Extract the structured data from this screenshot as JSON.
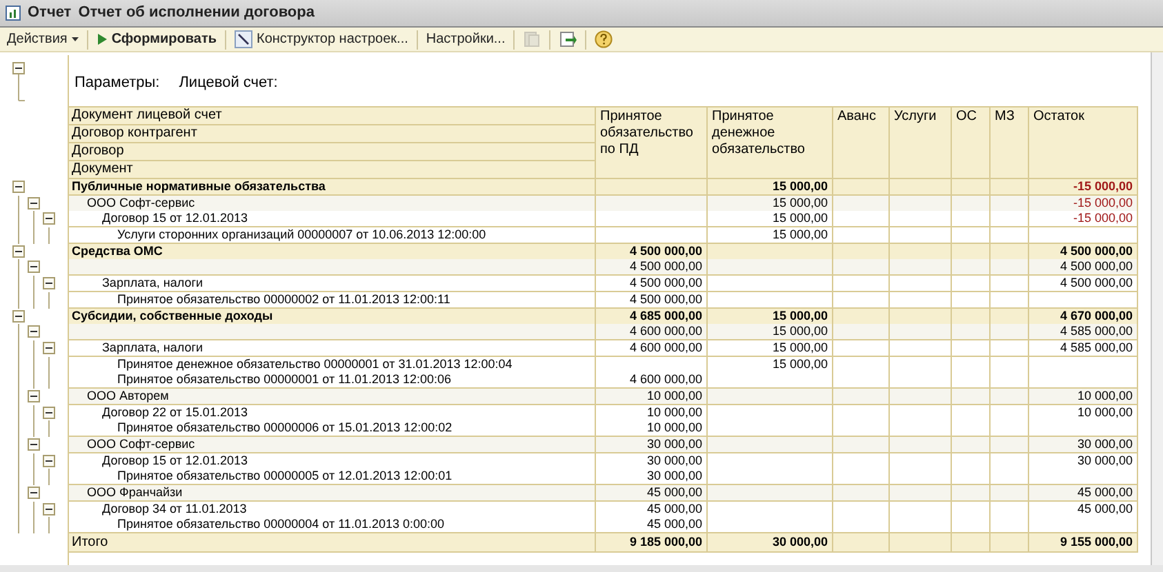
{
  "window": {
    "kind_label": "Отчет",
    "title": "Отчет об исполнении договора"
  },
  "toolbar": [
    {
      "kind": "menu",
      "label": "Действия",
      "disabled": false
    },
    {
      "kind": "run",
      "label": "Сформировать",
      "disabled": false
    },
    {
      "kind": "constructor",
      "label": "Конструктор настроек...",
      "disabled": false
    },
    {
      "kind": "text",
      "label": "Настройки...",
      "disabled": false
    },
    {
      "kind": "copy",
      "disabled": true
    },
    {
      "kind": "export",
      "disabled": false
    },
    {
      "kind": "help",
      "disabled": false
    }
  ],
  "parameters": {
    "label": "Параметры:",
    "value": "Лицевой счет:",
    "expanded": true
  },
  "header": {
    "name_rows": [
      "Документ лицевой счет",
      "Договор контрагент",
      "Договор",
      "Документ"
    ],
    "columns": [
      "Принятое обязательство по ПД",
      "Принятое денежное обязательство",
      "Аванс",
      "Услуги",
      "ОС",
      "МЗ",
      "Остаток"
    ]
  },
  "rows": [
    {
      "name": "Публичные нормативные обязательства",
      "money": "15 000,00",
      "rest": "-15 000,00",
      "negative": true,
      "expanded": true,
      "children": [
        {
          "name": "ООО Софт-сервис",
          "money": "15 000,00",
          "rest": "-15 000,00",
          "negative": true,
          "expanded": true,
          "children": [
            {
              "name": "Договор 15 от 12.01.2013",
              "money": "15 000,00",
              "rest": "-15 000,00",
              "negative": true,
              "expanded": true,
              "children": [
                {
                  "name": "Услуги сторонних организаций 00000007 от 10.06.2013 12:00:00",
                  "money": "15 000,00"
                }
              ]
            }
          ]
        }
      ]
    },
    {
      "name": "Средства ОМС",
      "pd": "4 500 000,00",
      "rest": "4 500 000,00",
      "negative": false,
      "expanded": true,
      "children": [
        {
          "pd": "4 500 000,00",
          "rest": "4 500 000,00",
          "negative": false,
          "expanded": true,
          "children": [
            {
              "name": "Зарплата, налоги",
              "pd": "4 500 000,00",
              "rest": "4 500 000,00",
              "negative": false,
              "expanded": true,
              "children": [
                {
                  "name": "Принятое обязательство 00000002 от 11.01.2013 12:00:11",
                  "pd": "4 500 000,00"
                }
              ]
            }
          ]
        }
      ]
    },
    {
      "name": "Субсидии, собственные доходы",
      "pd": "4 685 000,00",
      "money": "15 000,00",
      "rest": "4 670 000,00",
      "negative": false,
      "expanded": true,
      "children": [
        {
          "pd": "4 600 000,00",
          "money": "15 000,00",
          "rest": "4 585 000,00",
          "negative": false,
          "expanded": true,
          "children": [
            {
              "name": "Зарплата, налоги",
              "pd": "4 600 000,00",
              "money": "15 000,00",
              "rest": "4 585 000,00",
              "negative": false,
              "expanded": true,
              "children": [
                {
                  "name": "Принятое денежное обязательство 00000001 от 31.01.2013 12:00:04",
                  "money": "15 000,00"
                },
                {
                  "name": "Принятое обязательство 00000001 от 11.01.2013 12:00:06",
                  "pd": "4 600 000,00"
                }
              ]
            }
          ]
        },
        {
          "name": "ООО Авторем",
          "pd": "10 000,00",
          "rest": "10 000,00",
          "negative": false,
          "expanded": true,
          "children": [
            {
              "name": "Договор 22 от 15.01.2013",
              "pd": "10 000,00",
              "rest": "10 000,00",
              "negative": false,
              "expanded": true,
              "children": [
                {
                  "name": "Принятое обязательство 00000006 от 15.01.2013 12:00:02",
                  "pd": "10 000,00"
                }
              ]
            }
          ]
        },
        {
          "name": "ООО Софт-сервис",
          "pd": "30 000,00",
          "rest": "30 000,00",
          "negative": false,
          "expanded": true,
          "children": [
            {
              "name": "Договор 15 от 12.01.2013",
              "pd": "30 000,00",
              "rest": "30 000,00",
              "negative": false,
              "expanded": true,
              "children": [
                {
                  "name": "Принятое обязательство 00000005 от 12.01.2013 12:00:01",
                  "pd": "30 000,00"
                }
              ]
            }
          ]
        },
        {
          "name": "ООО Франчайзи",
          "pd": "45 000,00",
          "rest": "45 000,00",
          "negative": false,
          "expanded": true,
          "children": [
            {
              "name": "Договор 34 от 11.01.2013",
              "pd": "45 000,00",
              "rest": "45 000,00",
              "negative": false,
              "expanded": true,
              "children": [
                {
                  "name": "Принятое обязательство 00000004 от 11.01.2013 0:00:00",
                  "pd": "45 000,00"
                }
              ]
            }
          ]
        }
      ]
    }
  ],
  "total": {
    "label": "Итого",
    "pd": "9 185 000,00",
    "money": "30 000,00",
    "rest": "9 155 000,00"
  }
}
